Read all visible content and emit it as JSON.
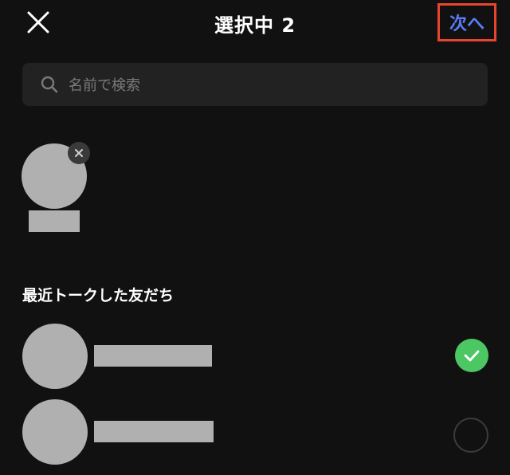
{
  "header": {
    "title": "選択中 2",
    "next_label": "次へ",
    "close_icon": "close-icon"
  },
  "search": {
    "placeholder": "名前で検索",
    "value": ""
  },
  "selected": {
    "items": [
      {
        "avatar": "avatar-placeholder",
        "remove_icon": "remove-icon"
      }
    ]
  },
  "recent": {
    "heading": "最近トークした友だち",
    "friends": [
      {
        "checked": true
      },
      {
        "checked": false
      }
    ]
  },
  "colors": {
    "background": "#111111",
    "next_text": "#5b7cf6",
    "highlight_border": "#e8452c",
    "check_green": "#4cc764",
    "placeholder_gray": "#b0b0b0"
  }
}
